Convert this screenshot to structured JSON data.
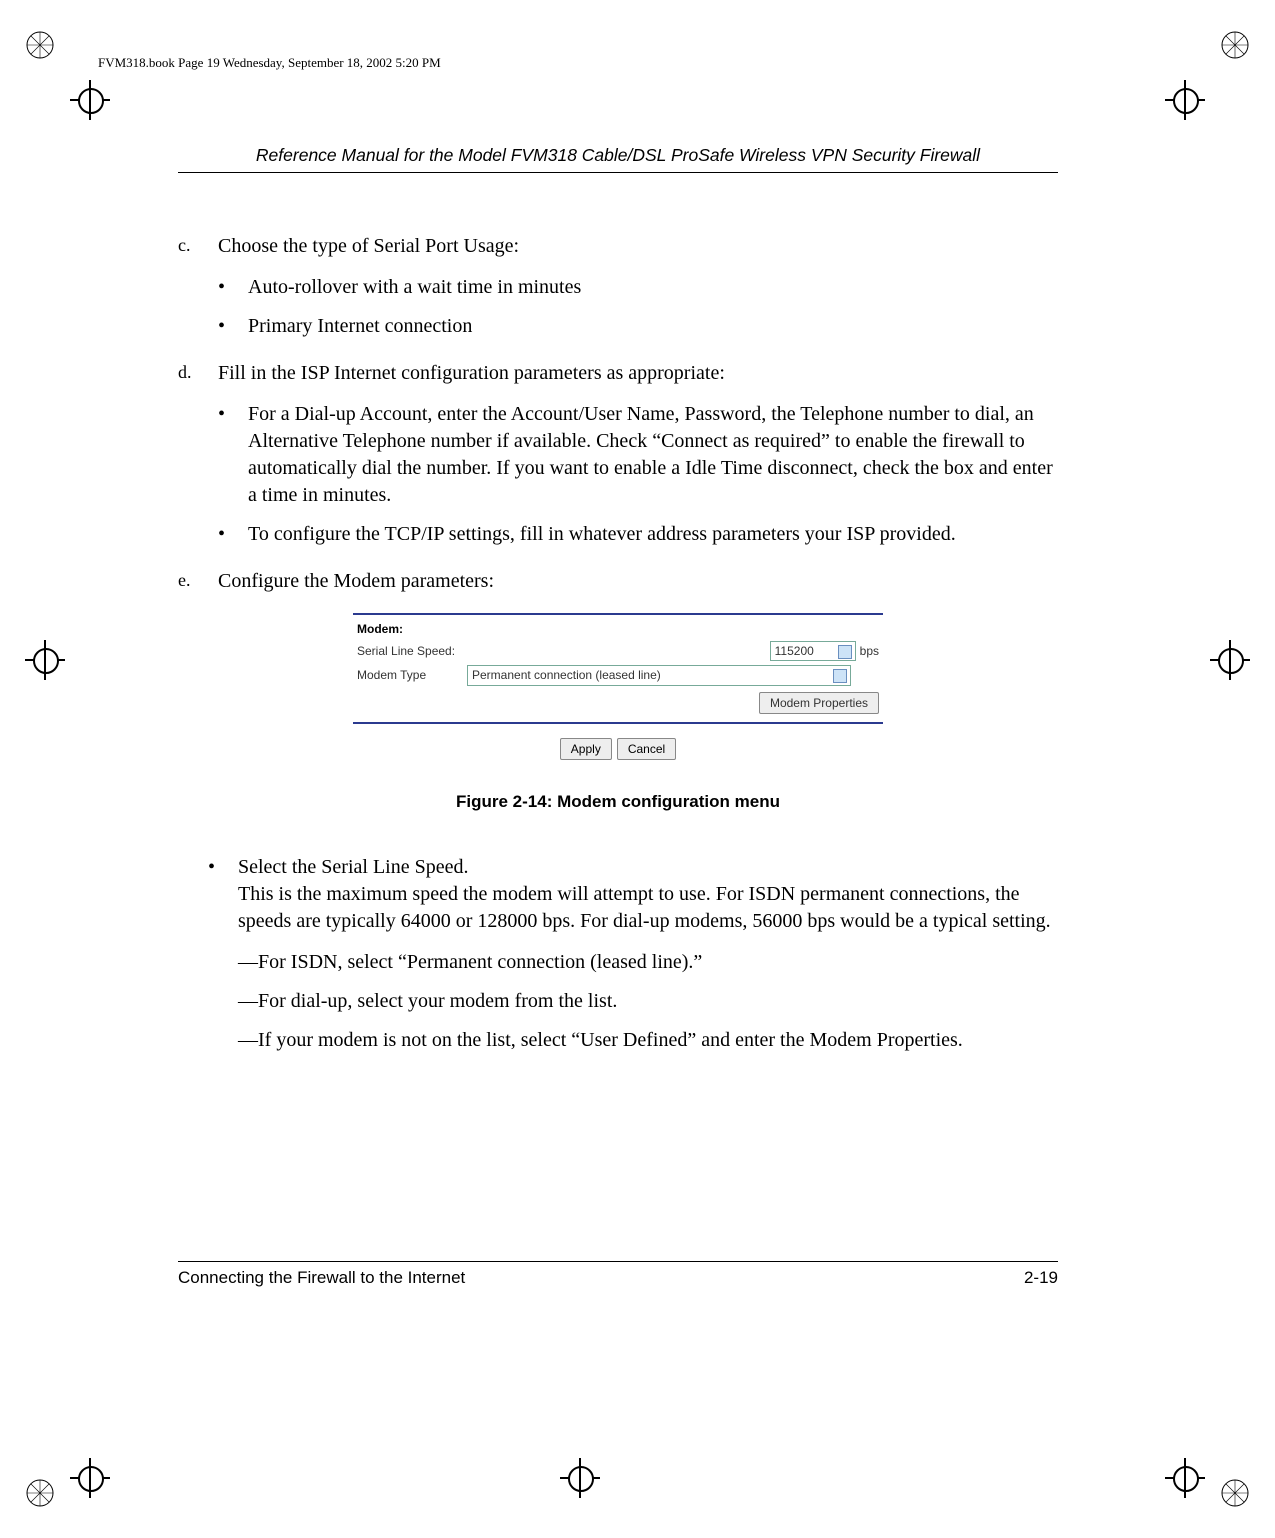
{
  "page_header_line": "FVM318.book  Page 19  Wednesday, September 18, 2002  5:20 PM",
  "running_head": "Reference Manual for the Model FVM318 Cable/DSL ProSafe Wireless VPN Security Firewall",
  "steps": {
    "c": {
      "label": "c.",
      "text": "Choose the type of Serial Port Usage:",
      "bullets": [
        "Auto-rollover with a wait time in minutes",
        "Primary Internet connection"
      ]
    },
    "d": {
      "label": "d.",
      "text": "Fill in the ISP Internet configuration parameters as appropriate:",
      "bullets": [
        "For a Dial-up Account, enter the Account/User Name, Password, the Telephone number to dial, an Alternative Telephone number if available. Check “Connect as required” to enable the firewall to automatically dial the number. If you want to enable a Idle Time disconnect, check the box and enter a time in minutes.",
        "To configure the TCP/IP settings, fill in whatever address parameters your ISP provided."
      ]
    },
    "e": {
      "label": "e.",
      "text": "Configure the Modem parameters:"
    }
  },
  "modem_ui": {
    "heading": "Modem:",
    "serial_label": "Serial Line Speed:",
    "serial_value": "115200",
    "bps": "bps",
    "type_label": "Modem Type",
    "type_value": "Permanent connection (leased line)",
    "properties_btn": "Modem Properties",
    "apply_btn": "Apply",
    "cancel_btn": "Cancel"
  },
  "figure_caption": "Figure 2-14: Modem configuration menu",
  "after_figure": {
    "bullet_lead": "Select the Serial Line Speed.",
    "bullet_body": "This is the maximum speed the modem will attempt to use. For ISDN permanent connections, the speeds are typically 64000 or 128000 bps. For dial-up modems, 56000 bps would be a typical setting.",
    "dashes": [
      "—For ISDN, select “Permanent connection (leased line).”",
      "—For dial-up, select your modem from the list.",
      "—If your modem is not on the list, select “User Defined” and enter the Modem Properties."
    ]
  },
  "footer": {
    "left": "Connecting the Firewall to the Internet",
    "right": "2-19"
  }
}
